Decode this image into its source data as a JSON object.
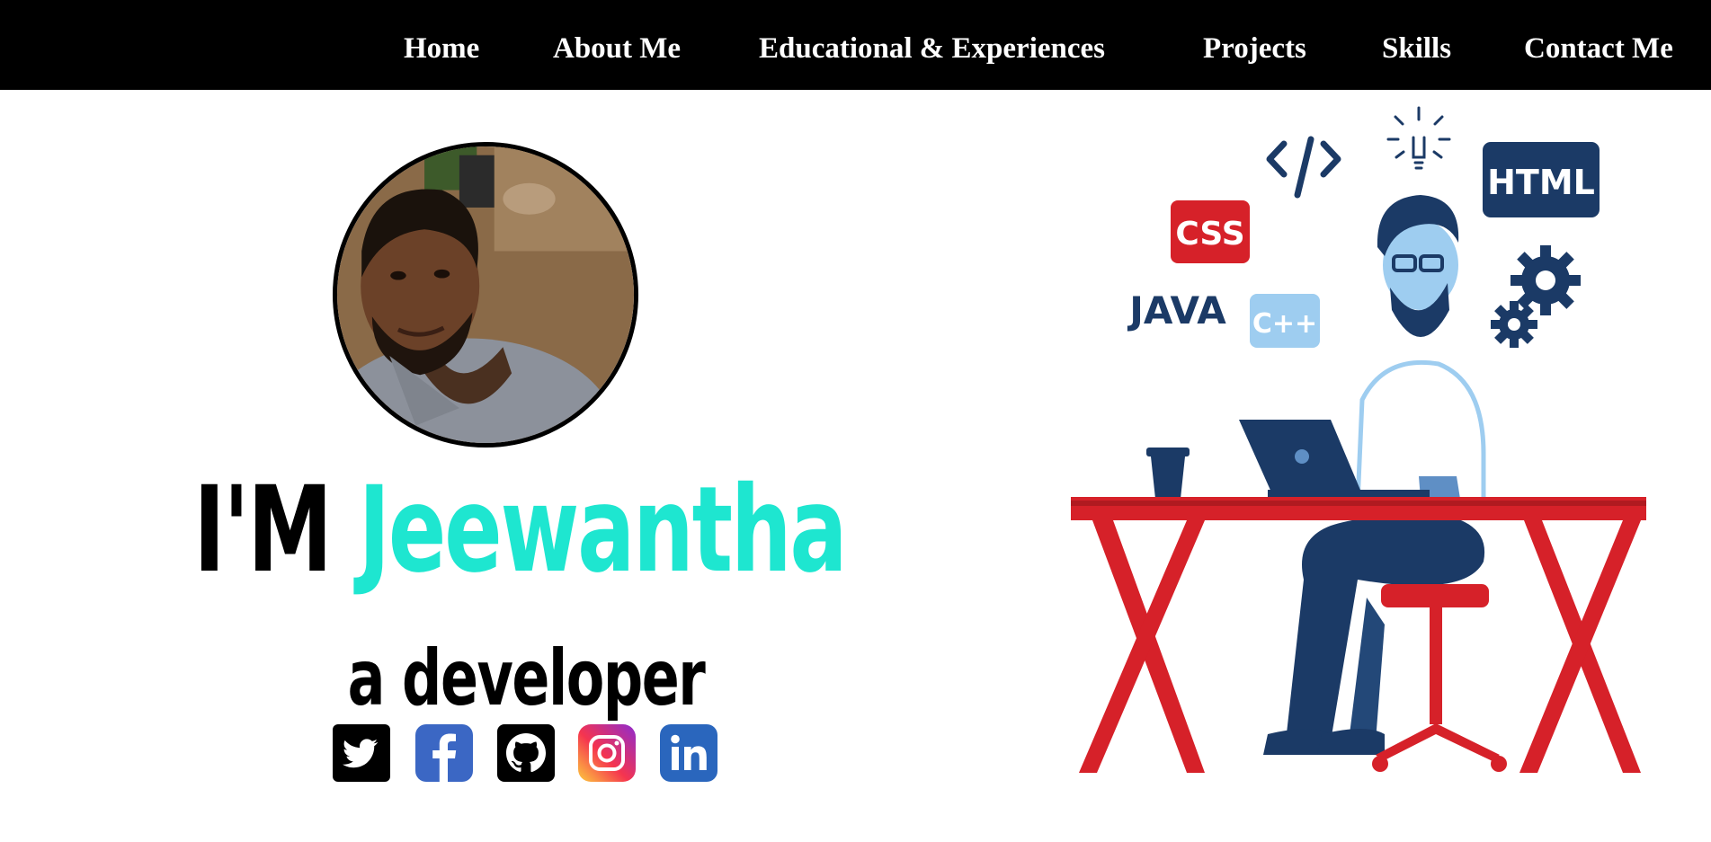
{
  "nav": {
    "items": [
      "Home",
      "About Me",
      "Educational & Experiences",
      "Projects",
      "Skills",
      "Contact Me"
    ]
  },
  "hero": {
    "prefix": "I'M",
    "name": "Jeewantha",
    "subtitle": "a developer"
  },
  "social": [
    "twitter-icon",
    "facebook-icon",
    "github-icon",
    "instagram-icon",
    "linkedin-icon"
  ],
  "illustration": {
    "tags": {
      "css": "CSS",
      "html": "HTML",
      "java": "JAVA",
      "cpp": "C++",
      "code": "</>"
    }
  },
  "colors": {
    "navbar_bg": "#000000",
    "accent": "#1ee6d0",
    "desk_red": "#d62129",
    "navy": "#1b3a66"
  }
}
